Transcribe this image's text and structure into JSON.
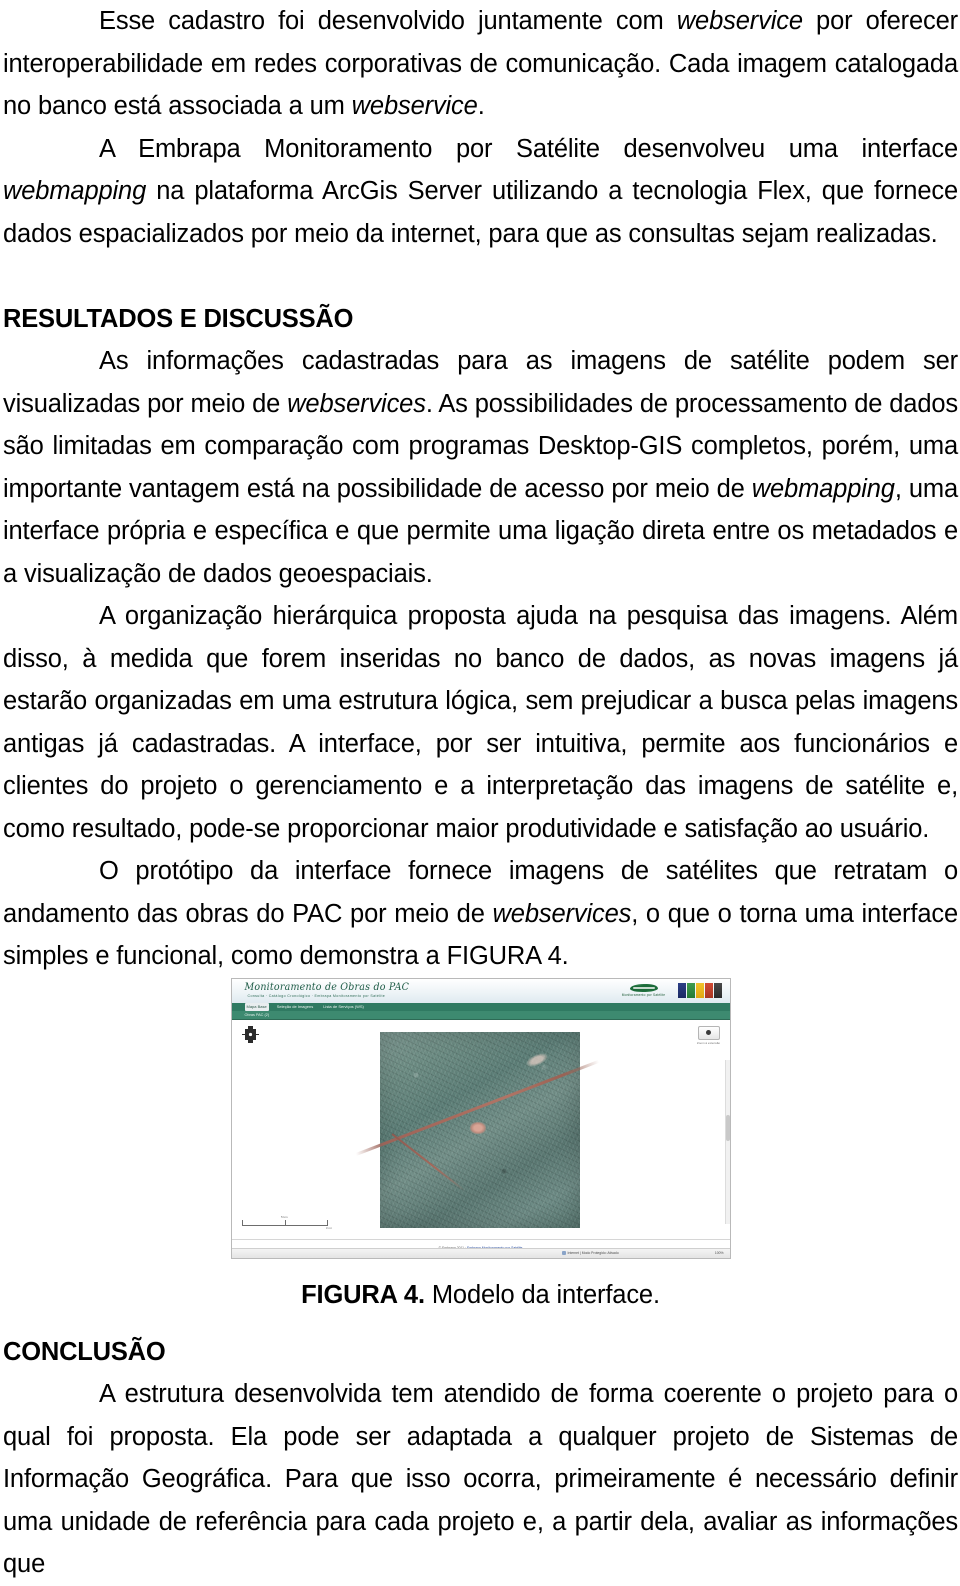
{
  "document": {
    "paragraphs": [
      {
        "id": "p-cadastro",
        "runs": [
          {
            "text": "Esse cadastro foi desenvolvido juntamente com ",
            "style": "normal"
          },
          {
            "text": "webservice",
            "style": "italic"
          },
          {
            "text": " por oferecer interoperabilidade em redes corporativas de comunicação. Cada imagem catalogada no banco está associada a um ",
            "style": "normal"
          },
          {
            "text": "webservice",
            "style": "italic"
          },
          {
            "text": ".",
            "style": "normal"
          }
        ]
      },
      {
        "id": "p-embrapa",
        "runs": [
          {
            "text": "A Embrapa Monitoramento por Satélite desenvolveu uma interface ",
            "style": "normal"
          },
          {
            "text": "webmapping",
            "style": "italic"
          },
          {
            "text": " na plataforma ArcGis Server utilizando a tecnologia Flex, que fornece dados espacializados por meio da internet, para que as consultas sejam realizadas.",
            "style": "normal"
          }
        ]
      },
      {
        "id": "p-informacoes",
        "runs": [
          {
            "text": "As informações cadastradas para as imagens de satélite podem ser visualizadas por meio de ",
            "style": "normal"
          },
          {
            "text": "webservices",
            "style": "italic"
          },
          {
            "text": ". As possibilidades de processamento de dados são limitadas em comparação com programas Desktop-GIS completos, porém, uma importante vantagem está na possibilidade de acesso por meio de ",
            "style": "normal"
          },
          {
            "text": "webmapping",
            "style": "italic"
          },
          {
            "text": ", uma interface própria e específica e que permite uma ligação direta entre os metadados e a visualização de dados geoespaciais.",
            "style": "normal"
          }
        ]
      },
      {
        "id": "p-organizacao",
        "runs": [
          {
            "text": "A organização hierárquica proposta ajuda na pesquisa das imagens. Além disso, à medida que forem inseridas no banco de dados, as novas imagens já estarão organizadas em uma estrutura lógica, sem prejudicar a busca pelas imagens antigas já cadastradas. A interface, por ser intuitiva, permite aos funcionários e clientes do projeto o gerenciamento e a interpretação das imagens de satélite e, como resultado, pode-se proporcionar maior produtividade e satisfação ao usuário.",
            "style": "normal"
          }
        ]
      },
      {
        "id": "p-prototipo",
        "runs": [
          {
            "text": "O protótipo da interface fornece imagens de satélites que retratam o andamento das obras do PAC por meio de ",
            "style": "normal"
          },
          {
            "text": "webservices",
            "style": "italic"
          },
          {
            "text": ", o que o torna uma interface simples e funcional, como demonstra a FIGURA 4.",
            "style": "normal"
          }
        ]
      },
      {
        "id": "p-conclusao-1",
        "runs": [
          {
            "text": "A estrutura desenvolvida tem atendido de forma coerente o projeto para o qual foi proposta. Ela pode ser adaptada a qualquer projeto de Sistemas de Informação Geográfica. Para que isso ocorra, primeiramente é necessário definir uma unidade de referência para cada projeto e, a partir dela, avaliar as informações que",
            "style": "normal"
          }
        ]
      }
    ],
    "headings": {
      "resultados": "RESULTADOS E DISCUSSÃO",
      "conclusao": "CONCLUSÃO"
    }
  },
  "figure": {
    "caption_label": "FIGURA 4.",
    "caption_text": " Modelo da interface.",
    "screenshot": {
      "brand_title": "Monitoramento de Obras do PAC",
      "brand_subtitle": "Consulta · Catálogo Cronológico · Embrapa Monitoramento por Satélite",
      "menu_items": [
        {
          "label": "Mapa Base",
          "active": true
        },
        {
          "label": "Seleção de Imagens",
          "active": false
        },
        {
          "label": "Lista de Serviços (WS)",
          "active": false
        }
      ],
      "sub_bar_text": "Obras PAC (2)",
      "pan_control_name": "Controle de navegação",
      "zoom_button_label": "Zoom à extensão",
      "scalebar": {
        "top_label": "5 km",
        "bottom_label": "3 mi"
      },
      "footer_text": "© Embrapa 2011 · ",
      "footer_link": "Embrapa Monitoramento por Satélite",
      "status_zone": "Internet | Modo Protegido: Ativado",
      "status_zoom": "100%",
      "logos": {
        "embrapa_caption": "Monitoramento por Satélite",
        "gov_colors": [
          "#2c3f86",
          "#3f9b4f",
          "#f2c32c",
          "#d14b35",
          "#4a4a4a"
        ]
      },
      "map": {
        "alt": "Imagem de satélite de relevo com estrada avermelhada em diagonal"
      }
    }
  },
  "colors": {
    "menu_green": "#2f7a62",
    "subbar_green": "#3d8a70",
    "brand_green": "#1d5b45",
    "link_blue": "#2b4fa0"
  }
}
